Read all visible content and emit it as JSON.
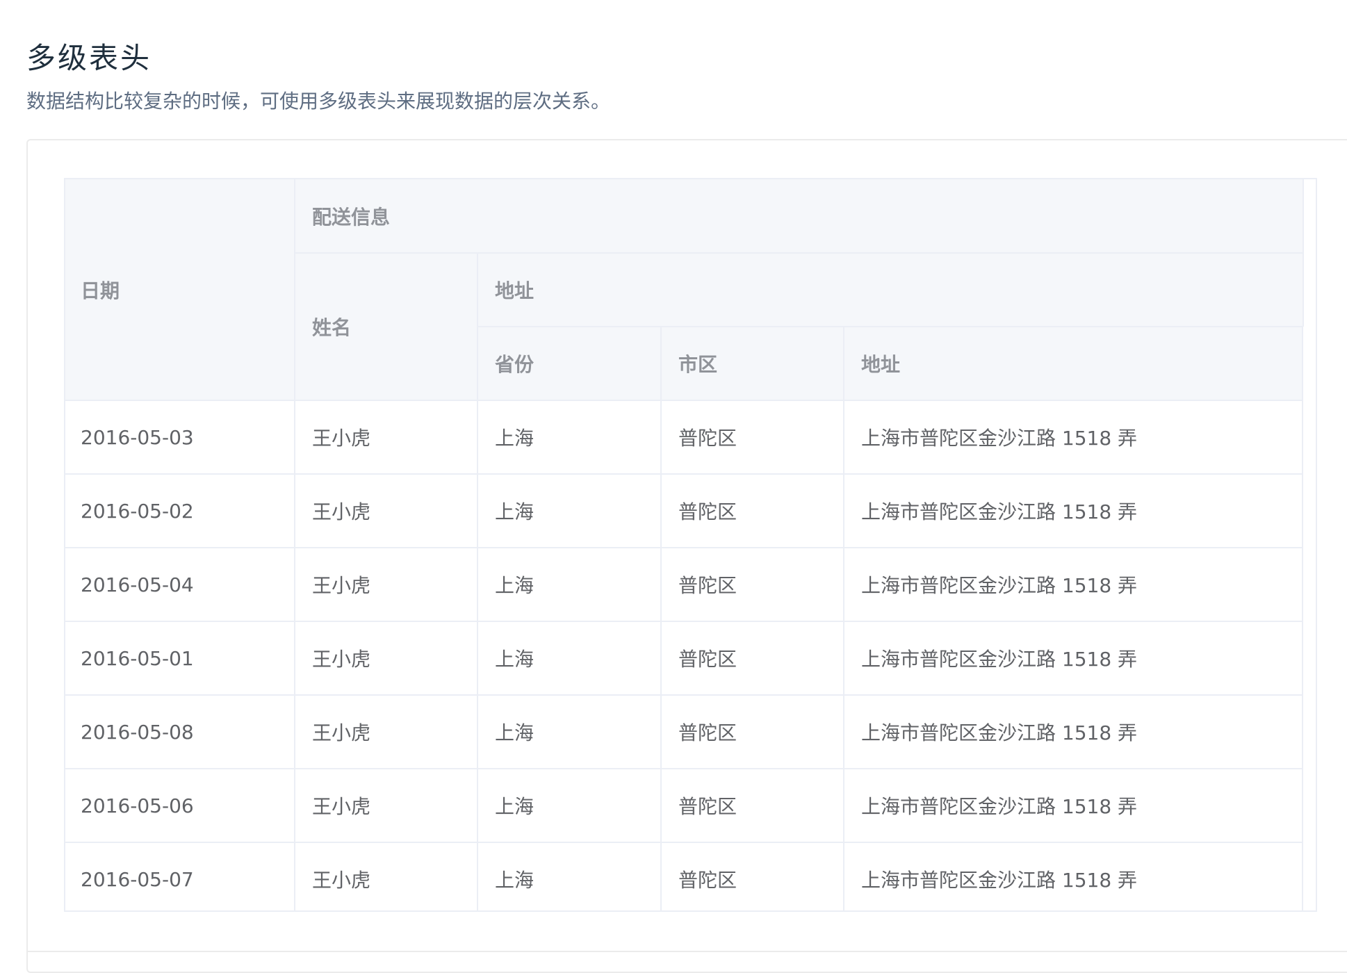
{
  "page": {
    "title": "多级表头",
    "description": "数据结构比较复杂的时候，可使用多级表头来展现数据的层次关系。"
  },
  "table": {
    "headers": {
      "date": "日期",
      "delivery_info": "配送信息",
      "name": "姓名",
      "address_group": "地址",
      "province": "省份",
      "city": "市区",
      "address": "地址"
    },
    "rows": [
      {
        "date": "2016-05-03",
        "name": "王小虎",
        "province": "上海",
        "city": "普陀区",
        "address": "上海市普陀区金沙江路 1518 弄"
      },
      {
        "date": "2016-05-02",
        "name": "王小虎",
        "province": "上海",
        "city": "普陀区",
        "address": "上海市普陀区金沙江路 1518 弄"
      },
      {
        "date": "2016-05-04",
        "name": "王小虎",
        "province": "上海",
        "city": "普陀区",
        "address": "上海市普陀区金沙江路 1518 弄"
      },
      {
        "date": "2016-05-01",
        "name": "王小虎",
        "province": "上海",
        "city": "普陀区",
        "address": "上海市普陀区金沙江路 1518 弄"
      },
      {
        "date": "2016-05-08",
        "name": "王小虎",
        "province": "上海",
        "city": "普陀区",
        "address": "上海市普陀区金沙江路 1518 弄"
      },
      {
        "date": "2016-05-06",
        "name": "王小虎",
        "province": "上海",
        "city": "普陀区",
        "address": "上海市普陀区金沙江路 1518 弄"
      },
      {
        "date": "2016-05-07",
        "name": "王小虎",
        "province": "上海",
        "city": "普陀区",
        "address": "上海市普陀区金沙江路 1518 弄"
      }
    ]
  },
  "colors": {
    "header_bg": "#f5f7fa",
    "header_text": "#909399",
    "cell_text": "#606266",
    "border": "#ebeef5",
    "title_text": "#1f2f3d",
    "description_text": "#5e6d82"
  }
}
